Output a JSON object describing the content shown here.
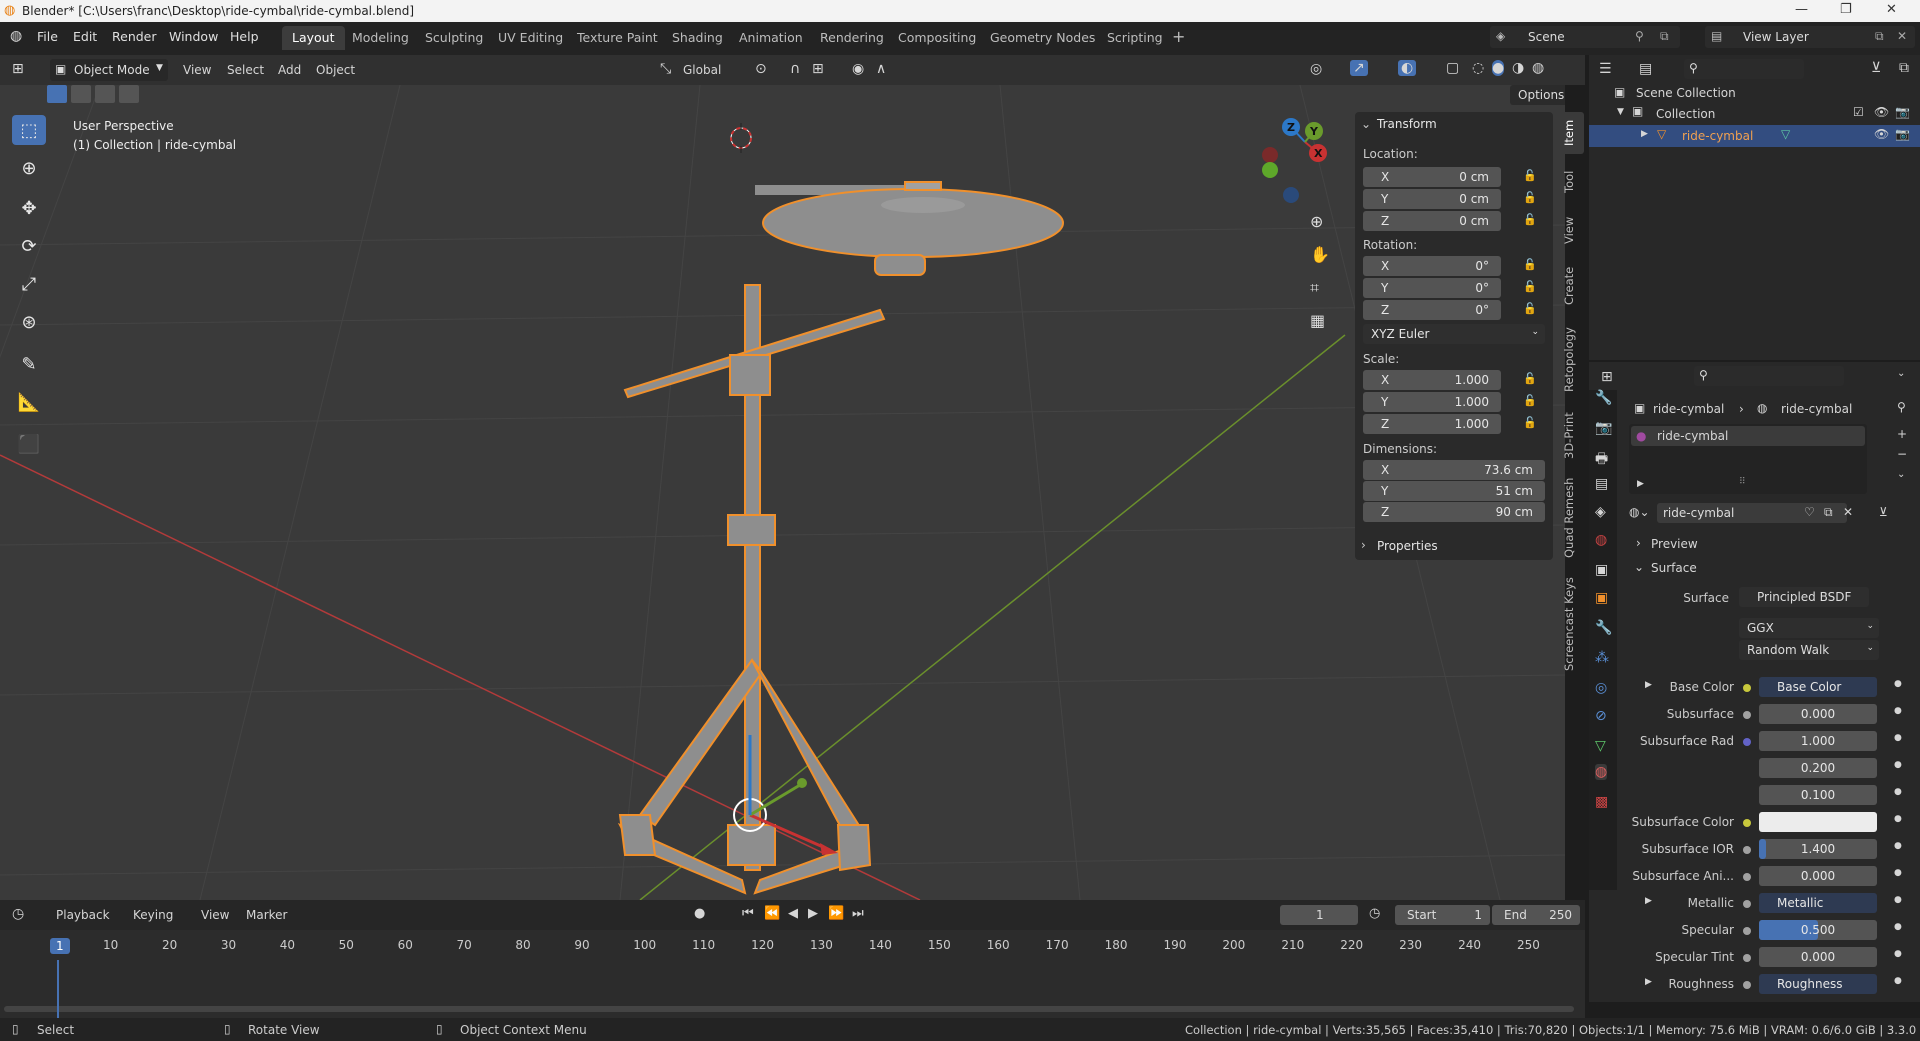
{
  "window": {
    "title": "Blender* [C:\\Users\\franc\\Desktop\\ride-cymbal\\ride-cymbal.blend]",
    "minimize": "—",
    "maximize": "❐",
    "close": "✕"
  },
  "menus": [
    "File",
    "Edit",
    "Render",
    "Window",
    "Help"
  ],
  "workspaces": [
    "Layout",
    "Modeling",
    "Sculpting",
    "UV Editing",
    "Texture Paint",
    "Shading",
    "Animation",
    "Rendering",
    "Compositing",
    "Geometry Nodes",
    "Scripting"
  ],
  "active_workspace": "Layout",
  "add_workspace": "+",
  "scene": {
    "label": "Scene"
  },
  "view_layer": {
    "label": "View Layer"
  },
  "viewport_header": {
    "mode": "Object Mode",
    "menus": [
      "View",
      "Select",
      "Add",
      "Object"
    ],
    "orientation": "Global",
    "options": "Options"
  },
  "viewport": {
    "perspective": "User Perspective",
    "collection_info": "(1) Collection | ride-cymbal",
    "gizmo_axes": {
      "x": "X",
      "y": "Y",
      "z": "Z"
    }
  },
  "n_panel": {
    "transform_header": "Transform",
    "location_label": "Location:",
    "location": [
      {
        "axis": "X",
        "value": "0 cm"
      },
      {
        "axis": "Y",
        "value": "0 cm"
      },
      {
        "axis": "Z",
        "value": "0 cm"
      }
    ],
    "rotation_label": "Rotation:",
    "rotation": [
      {
        "axis": "X",
        "value": "0°"
      },
      {
        "axis": "Y",
        "value": "0°"
      },
      {
        "axis": "Z",
        "value": "0°"
      }
    ],
    "rotation_mode": "XYZ Euler",
    "scale_label": "Scale:",
    "scale": [
      {
        "axis": "X",
        "value": "1.000"
      },
      {
        "axis": "Y",
        "value": "1.000"
      },
      {
        "axis": "Z",
        "value": "1.000"
      }
    ],
    "dimensions_label": "Dimensions:",
    "dimensions": [
      {
        "axis": "X",
        "value": "73.6 cm"
      },
      {
        "axis": "Y",
        "value": "51 cm"
      },
      {
        "axis": "Z",
        "value": "90 cm"
      }
    ],
    "properties_header": "Properties",
    "tabs": [
      "Item",
      "Tool",
      "View",
      "Create",
      "Retopology",
      "3D-Print",
      "Quad Remesh",
      "Screencast Keys"
    ]
  },
  "outliner": {
    "scene_collection": "Scene Collection",
    "collection": "Collection",
    "object": "ride-cymbal"
  },
  "properties": {
    "breadcrumb_object": "ride-cymbal",
    "breadcrumb_material": "ride-cymbal",
    "slot": "ride-cymbal",
    "material_name": "ride-cymbal",
    "preview": "Preview",
    "surface_header": "Surface",
    "surface_label": "Surface",
    "surface_value": "Principled BSDF",
    "distribution": "GGX",
    "subsurface_method": "Random Walk",
    "rows": [
      {
        "label": "Base Color",
        "value": "Base Color",
        "dot": "#c8c83c",
        "kind": "link",
        "expand": true
      },
      {
        "label": "Subsurface",
        "value": "0.000",
        "dot": "#a1a1a1",
        "kind": "num"
      },
      {
        "label": "Subsurface Rad",
        "value": "1.000",
        "dot": "#6363c7",
        "kind": "num"
      },
      {
        "label": "",
        "value": "0.200",
        "kind": "num"
      },
      {
        "label": "",
        "value": "0.100",
        "kind": "num"
      },
      {
        "label": "Subsurface Color",
        "value": "",
        "dot": "#c8c83c",
        "kind": "color"
      },
      {
        "label": "Subsurface IOR",
        "value": "1.400",
        "dot": "#a1a1a1",
        "kind": "num",
        "fill": 0.06
      },
      {
        "label": "Subsurface Ani...",
        "value": "0.000",
        "dot": "#a1a1a1",
        "kind": "num"
      },
      {
        "label": "Metallic",
        "value": "Metallic",
        "dot": "#a1a1a1",
        "kind": "link",
        "expand": true
      },
      {
        "label": "Specular",
        "value": "0.500",
        "dot": "#a1a1a1",
        "kind": "num",
        "fill": 0.5
      },
      {
        "label": "Specular Tint",
        "value": "0.000",
        "dot": "#a1a1a1",
        "kind": "num"
      },
      {
        "label": "Roughness",
        "value": "Roughness",
        "dot": "#a1a1a1",
        "kind": "link",
        "expand": true
      }
    ]
  },
  "timeline": {
    "menus": [
      "Playback",
      "Keying",
      "View",
      "Marker"
    ],
    "current_frame": "1",
    "start_label": "Start",
    "start": "1",
    "end_label": "End",
    "end": "250",
    "ticks": [
      "1",
      "10",
      "20",
      "30",
      "40",
      "50",
      "60",
      "70",
      "80",
      "90",
      "100",
      "110",
      "120",
      "130",
      "140",
      "150",
      "160",
      "170",
      "180",
      "190",
      "200",
      "210",
      "220",
      "230",
      "240",
      "250"
    ]
  },
  "statusbar": {
    "select": "Select",
    "rotate": "Rotate View",
    "context": "Object Context Menu",
    "stats": "Collection | ride-cymbal | Verts:35,565 | Faces:35,410 | Tris:70,820 | Objects:1/1 | Memory: 75.6 MiB | VRAM: 0.6/6.0 GiB | 3.3.0"
  },
  "colors": {
    "accent": "#4772b3",
    "selection": "#f0902c",
    "x_axis": "#c8323c",
    "y_axis": "#6a9b2c",
    "z_axis": "#2c78c8"
  }
}
